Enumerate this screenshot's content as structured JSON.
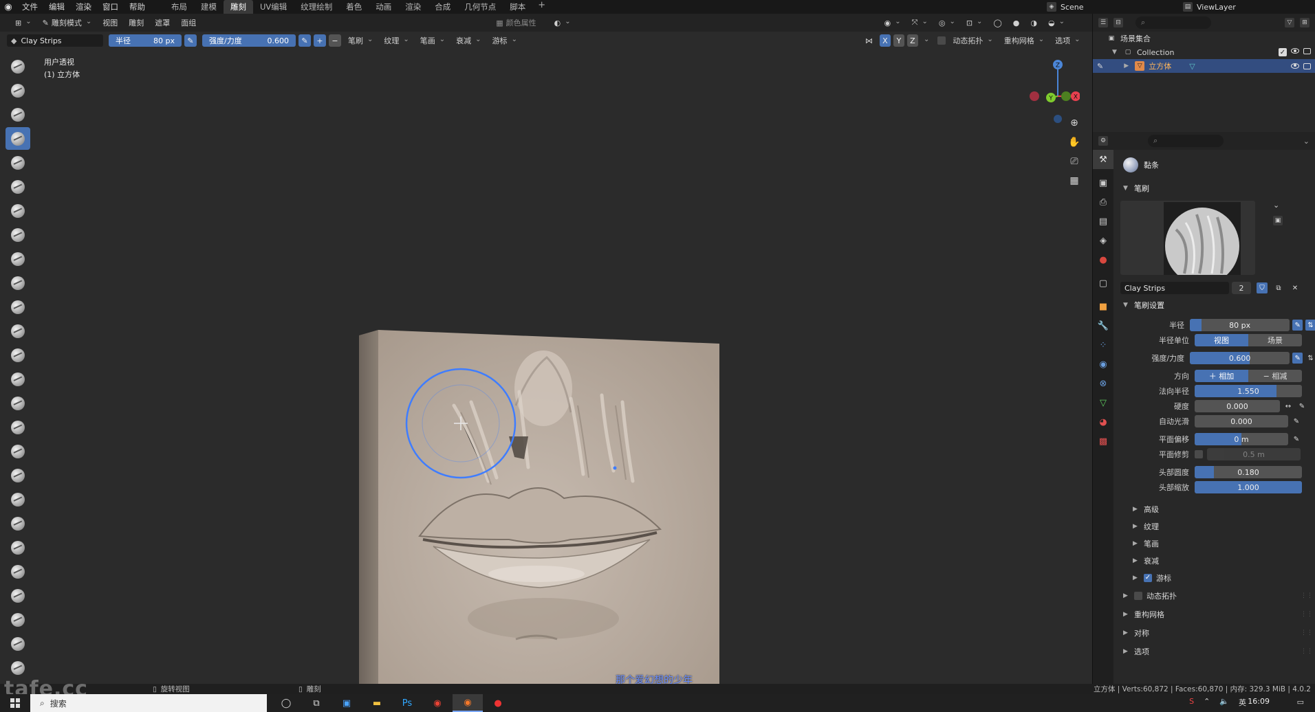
{
  "menu": {
    "items": [
      "文件",
      "编辑",
      "渲染",
      "窗口",
      "帮助"
    ],
    "workspaces": [
      "布局",
      "建模",
      "雕刻",
      "UV编辑",
      "纹理绘制",
      "着色",
      "动画",
      "渲染",
      "合成",
      "几何节点",
      "脚本"
    ],
    "active_workspace": "雕刻",
    "scene": "Scene",
    "view_layer": "ViewLayer"
  },
  "viewport_header": {
    "mode": "雕刻模式",
    "menus": [
      "视图",
      "雕刻",
      "遮罩",
      "面组"
    ],
    "color_attribute": "颜色属性"
  },
  "tool_header": {
    "brush_name": "Clay Strips",
    "radius_label": "半径",
    "radius_value": "80 px",
    "strength_label": "强度/力度",
    "strength_value": "0.600",
    "menus": [
      "笔刷",
      "纹理",
      "笔画",
      "衰减",
      "游标"
    ],
    "axes": [
      "X",
      "Y",
      "Z"
    ],
    "dyntopo": "动态拓扑",
    "remesh": "重构网格",
    "options": "选项"
  },
  "view_info": {
    "line1": "用户透视",
    "line2": "(1) 立方体"
  },
  "gizmo": {
    "x_color": "#e8404f",
    "y_color": "#7fcc2e",
    "z_color": "#4b86d8",
    "z_label": "Z",
    "y_label": "Y",
    "x_label": "X"
  },
  "outliner": {
    "root": "场景集合",
    "collection": "Collection",
    "object": "立方体"
  },
  "properties": {
    "active_tool": "黏条",
    "brush_panel": "笔刷",
    "brush_name": "Clay Strips",
    "brush_users": "2",
    "settings_panel": "笔刷设置",
    "rows": [
      {
        "label": "半径",
        "value": "80 px",
        "fill": 0.12,
        "icons": true
      },
      {
        "label": "强度/力度",
        "value": "0.600",
        "fill": 0.6,
        "icons": true
      },
      {
        "label": "法向半径",
        "value": "1.550",
        "fill": 0.76,
        "icons": false
      },
      {
        "label": "硬度",
        "value": "0.000",
        "fill": 0.0,
        "icons": false
      },
      {
        "label": "自动光滑",
        "value": "0.000",
        "fill": 0.0,
        "icons": false
      },
      {
        "label": "平面偏移",
        "value": "0 m",
        "fill": 0.5,
        "icons": false
      },
      {
        "label": "平面修剪",
        "value": "0.5 m",
        "fill": 0.0,
        "icons": false
      },
      {
        "label": "头部圆度",
        "value": "0.180",
        "fill": 0.18,
        "icons": false
      },
      {
        "label": "头部缩放",
        "value": "1.000",
        "fill": 1.0,
        "icons": false
      }
    ],
    "radius_unit_label": "半径单位",
    "radius_unit_options": [
      "视图",
      "场景"
    ],
    "direction_label": "方向",
    "direction_options": [
      "相加",
      "相减"
    ],
    "sub_panels": [
      "高级",
      "纹理",
      "笔画",
      "衰减",
      "游标"
    ],
    "top_panels": [
      "动态拓扑",
      "重构网格",
      "对称",
      "选项"
    ]
  },
  "status": {
    "rotate_view": "旋转视图",
    "sculpt": "雕刻",
    "stats": "立方体 | Verts:60,872 | Faces:60,870 | 内存: 329.3 MiB | 4.0.2"
  },
  "subtitle": "那个爱幻想的少年",
  "watermark": "tafe.cc",
  "taskbar": {
    "search_placeholder": "搜索",
    "time": "16:09",
    "lang": "英"
  }
}
